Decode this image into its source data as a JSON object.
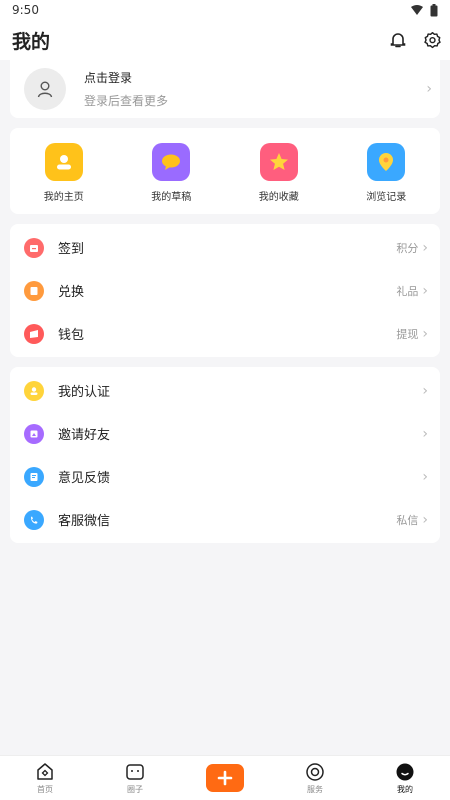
{
  "status": {
    "time": "9:50"
  },
  "header": {
    "title": "我的"
  },
  "login": {
    "title": "点击登录",
    "subtitle": "登录后查看更多"
  },
  "quick": [
    {
      "label": "我的主页",
      "icon": "home-person-icon",
      "color": "#ffc21a"
    },
    {
      "label": "我的草稿",
      "icon": "draft-chat-icon",
      "color": "#9a6bff"
    },
    {
      "label": "我的收藏",
      "icon": "star-icon",
      "color": "#ff5e7e"
    },
    {
      "label": "浏览记录",
      "icon": "location-pin-icon",
      "color": "#3aa8ff"
    }
  ],
  "group1": [
    {
      "label": "签到",
      "extra": "积分",
      "icon": "checkin-icon",
      "color": "#ff6b6b"
    },
    {
      "label": "兑换",
      "extra": "礼品",
      "icon": "exchange-icon",
      "color": "#ff9a3d"
    },
    {
      "label": "钱包",
      "extra": "提现",
      "icon": "wallet-icon",
      "color": "#ff5a5a"
    }
  ],
  "group2": [
    {
      "label": "我的认证",
      "extra": "",
      "icon": "verify-icon",
      "color": "#ffd43b"
    },
    {
      "label": "邀请好友",
      "extra": "",
      "icon": "invite-icon",
      "color": "#a66bff"
    },
    {
      "label": "意见反馈",
      "extra": "",
      "icon": "feedback-icon",
      "color": "#3aa8ff"
    },
    {
      "label": "客服微信",
      "extra": "私信",
      "icon": "customer-service-icon",
      "color": "#3aa8ff"
    }
  ],
  "tabs": [
    {
      "label": "首页",
      "icon": "home-icon"
    },
    {
      "label": "圈子",
      "icon": "circle-icon"
    },
    {
      "label": "",
      "icon": "plus-icon"
    },
    {
      "label": "服务",
      "icon": "service-icon"
    },
    {
      "label": "我的",
      "icon": "mine-icon"
    }
  ],
  "colors": {
    "accent": "#ff6a13",
    "title_mark": "#3aa8ff"
  }
}
